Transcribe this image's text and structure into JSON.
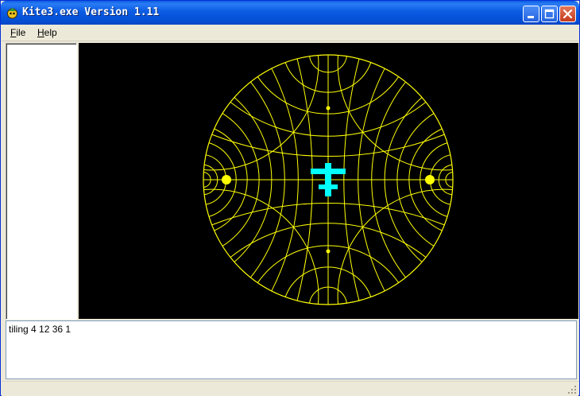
{
  "window": {
    "title": "Kite3.exe Version 1.11",
    "controls": [
      "minimize-icon",
      "maximize-icon",
      "close-icon"
    ]
  },
  "menu": {
    "items": [
      {
        "label": "File",
        "accelerator": "F"
      },
      {
        "label": "Help",
        "accelerator": "H"
      }
    ]
  },
  "canvas": {
    "background": "#000000",
    "tiling_color": "#ffff00",
    "marker_color": "#00ffff",
    "marker_icon": "cross-cursor-icon"
  },
  "console": {
    "text": "tiling 4 12 36 1"
  },
  "colors": {
    "titlebar": "#0a5be0",
    "chrome": "#ece9d8"
  }
}
